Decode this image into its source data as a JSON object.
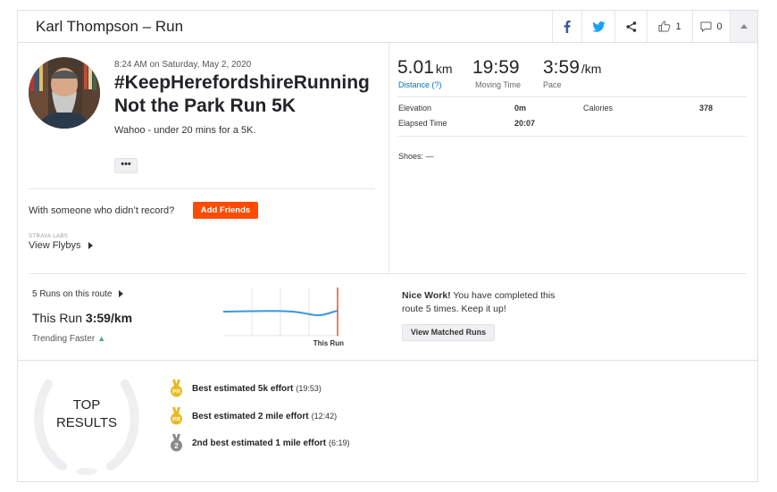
{
  "header": {
    "title": "Karl Thompson – Run",
    "kudos_count": "1",
    "comments_count": "0",
    "icons": [
      "facebook-icon",
      "twitter-icon",
      "share-icon",
      "thumbs-up-icon",
      "comment-icon",
      "chevron-up-icon"
    ]
  },
  "activity": {
    "datetime": "8:24 AM on Saturday, May 2, 2020",
    "title_line1": "#KeepHerefordshireRunning",
    "title_line2": "Not the Park Run 5K",
    "description": "Wahoo - under 20 mins for a 5K.",
    "more_label": "•••",
    "with_someone": "With someone who didn’t record?",
    "add_friends_label": "Add Friends",
    "labs_label": "STRAVA LABS",
    "flybys_label": "View Flybys"
  },
  "stats": {
    "distance_value": "5.01",
    "distance_unit": "km",
    "distance_label": "Distance (?)",
    "moving_time_value": "19:59",
    "moving_time_label": "Moving Time",
    "pace_value": "3:59",
    "pace_unit": "/km",
    "pace_label": "Pace",
    "elevation_label": "Elevation",
    "elevation_value": "0m",
    "calories_label": "Calories",
    "calories_value": "378",
    "elapsed_label": "Elapsed Time",
    "elapsed_value": "20:07",
    "shoes_label": "Shoes: —"
  },
  "route": {
    "runs_on_route": "5 Runs on this route",
    "this_run_prefix": "This Run",
    "this_run_pace": "3:59/km",
    "trending": "Trending Faster",
    "chart_label": "This Run",
    "nice_bold": "Nice Work!",
    "nice_text": "You have completed this route 5 times. Keep it up!",
    "view_matched_label": "View Matched Runs"
  },
  "top_results": {
    "title_line1": "TOP",
    "title_line2": "RESULTS",
    "items": [
      {
        "rank": "PR",
        "label": "Best estimated 5k effort",
        "time": "(19:53)",
        "medal_color": "#e8b923"
      },
      {
        "rank": "PR",
        "label": "Best estimated 2 mile effort",
        "time": "(12:42)",
        "medal_color": "#e8b923"
      },
      {
        "rank": "2",
        "label": "2nd best estimated 1 mile effort",
        "time": "(6:19)",
        "medal_color": "#8a8a8a"
      }
    ]
  },
  "colors": {
    "brand_orange": "#fc4c02",
    "link_blue": "#0074bf",
    "chart_line": "#3a9ad9",
    "facebook": "#3b5998",
    "twitter": "#1da1f2"
  }
}
